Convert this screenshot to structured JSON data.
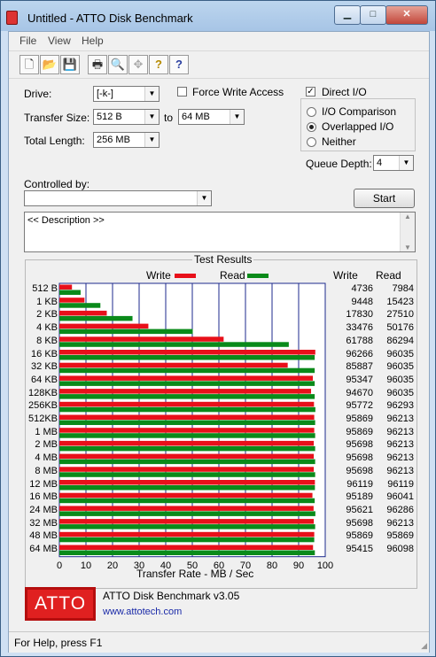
{
  "window": {
    "title": "Untitled - ATTO Disk Benchmark",
    "min_glyph": "▁",
    "max_glyph": "□",
    "close_glyph": "✕"
  },
  "menu": [
    "File",
    "View",
    "Help"
  ],
  "toolbar_icons": [
    "new-file-icon",
    "open-folder-icon",
    "save-icon",
    "print-icon",
    "print-preview-icon",
    "move-icon",
    "help-icon",
    "context-help-icon"
  ],
  "toolbar_glyphs": [
    "🗋",
    "📂",
    "💾",
    "🖶",
    "🔍",
    "✥",
    "?",
    "?"
  ],
  "form": {
    "drive_label": "Drive:",
    "drive_value": "[-k-]",
    "transfer_size_label": "Transfer Size:",
    "transfer_from": "512 B",
    "to_label": "to",
    "transfer_to": "64 MB",
    "total_length_label": "Total Length:",
    "total_length": "256 MB",
    "force_write_label": "Force Write Access",
    "force_write_checked": false,
    "direct_io_label": "Direct I/O",
    "direct_io_checked": true,
    "io_comparison_label": "I/O Comparison",
    "overlapped_io_label": "Overlapped I/O",
    "neither_label": "Neither",
    "selected_mode": "Overlapped I/O",
    "queue_depth_label": "Queue Depth:",
    "queue_depth": "4",
    "controlled_by_label": "Controlled by:",
    "controlled_by_value": "",
    "start_label": "Start",
    "description": "<< Description >>"
  },
  "results": {
    "title": "Test Results",
    "legend_write": "Write",
    "legend_read": "Read",
    "col_write": "Write",
    "col_read": "Read"
  },
  "chart_data": {
    "type": "bar",
    "orientation": "horizontal",
    "categories": [
      "512 B",
      "1 KB",
      "2 KB",
      "4 KB",
      "8 KB",
      "16 KB",
      "32 KB",
      "64 KB",
      "128KB",
      "256KB",
      "512KB",
      "1 MB",
      "2 MB",
      "4 MB",
      "8 MB",
      "12 MB",
      "16 MB",
      "24 MB",
      "32 MB",
      "48 MB",
      "64 MB"
    ],
    "series": [
      {
        "name": "Write",
        "color": "#e8101a",
        "values": [
          4736,
          9448,
          17830,
          33476,
          61788,
          96266,
          85887,
          95347,
          94670,
          95772,
          95869,
          95869,
          95698,
          95698,
          95698,
          96119,
          95189,
          95621,
          95698,
          95869,
          95415
        ]
      },
      {
        "name": "Read",
        "color": "#0a8a1a",
        "values": [
          7984,
          15423,
          27510,
          50176,
          86294,
          96035,
          96035,
          96035,
          96035,
          96293,
          96213,
          96213,
          96213,
          96213,
          96213,
          96119,
          96041,
          96286,
          96213,
          95869,
          96098
        ]
      }
    ],
    "xlim": [
      0,
      100
    ],
    "xticks": [
      0,
      10,
      20,
      30,
      40,
      50,
      60,
      70,
      80,
      90,
      100
    ],
    "xlabel": "Transfer Rate - MB / Sec",
    "bar_scale_note": "",
    "grid": true,
    "legend": "top"
  },
  "footer": {
    "logo": "ATTO",
    "product": "ATTO Disk Benchmark v3.05",
    "url": "www.attotech.com"
  },
  "status": "For Help, press F1"
}
